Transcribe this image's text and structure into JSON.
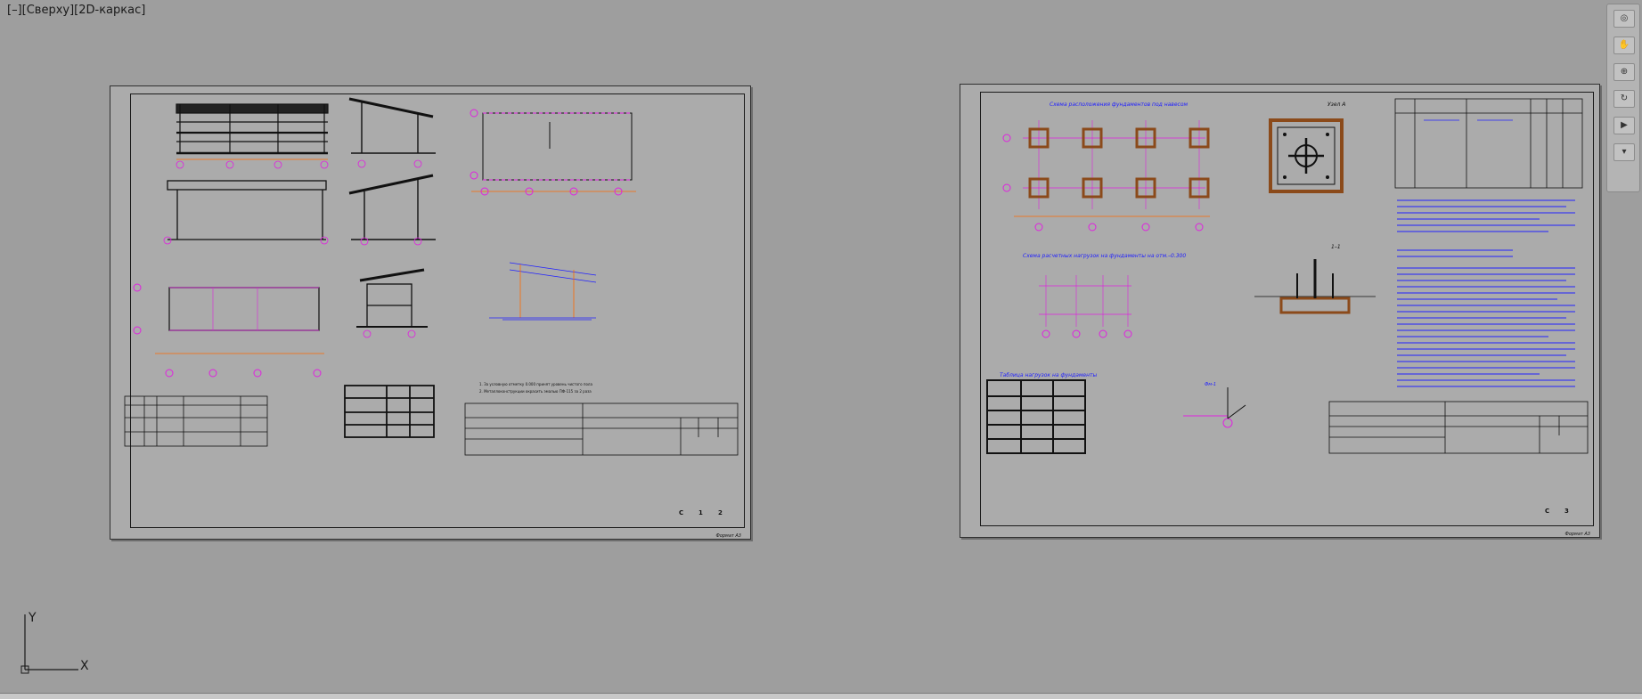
{
  "viewport": {
    "label": "[–][Сверху][2D-каркас]"
  },
  "sheet_left": {
    "sheet_number": "1",
    "sheet_count": "2",
    "stage": "С",
    "format": "Формат А3"
  },
  "sheet_right": {
    "sheet_number": "3",
    "stage": "С",
    "format": "Формат А3",
    "title_plan": "Схема расположения фундаментов под навесом",
    "title_loads": "Схема расчетных нагрузок на фундаменты на отм.–0.300",
    "title_table": "Таблица нагрузок на фундаменты",
    "title_nodes": "Узел А",
    "section_1_1": "1–1",
    "legend_foundation": "Фм-1"
  },
  "ucs": {
    "x_axis": "X",
    "y_axis": "Y"
  },
  "colors": {
    "background": "#9e9e9e",
    "sheet": "#ababab",
    "lines": "#111111",
    "magenta": "#e020e0",
    "orange": "#ff6a00",
    "blue": "#2020ff",
    "brown": "#8b4a1a"
  },
  "nav_icons": [
    "pan-icon",
    "zoom-icon",
    "orbit-icon",
    "wheel-icon",
    "showmotion-icon"
  ]
}
